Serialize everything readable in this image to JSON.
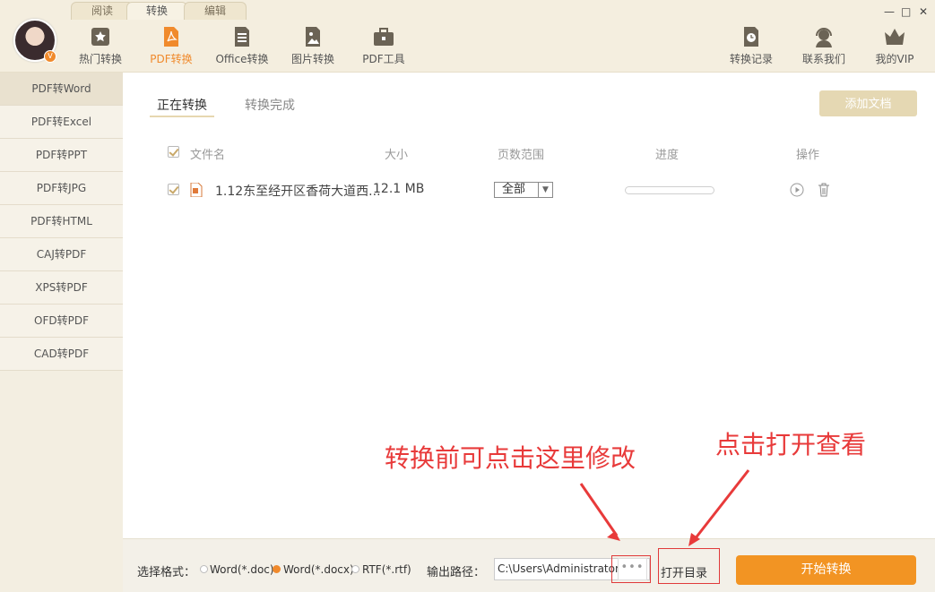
{
  "top_tabs": [
    "阅读",
    "转换",
    "编辑"
  ],
  "avatar_badge": "V",
  "nav": [
    {
      "label": "热门转换",
      "icon": "star-icon"
    },
    {
      "label": "PDF转换",
      "icon": "pdf-icon"
    },
    {
      "label": "Office转换",
      "icon": "document-icon"
    },
    {
      "label": "图片转换",
      "icon": "image-icon"
    },
    {
      "label": "PDF工具",
      "icon": "toolbox-icon"
    }
  ],
  "right_nav": [
    {
      "label": "转换记录",
      "icon": "clock-icon"
    },
    {
      "label": "联系我们",
      "icon": "headset-icon"
    },
    {
      "label": "我的VIP",
      "icon": "crown-icon"
    }
  ],
  "window_controls": {
    "minimize": "—",
    "maximize": "□",
    "close": "✕"
  },
  "sidebar": [
    "PDF转Word",
    "PDF转Excel",
    "PDF转PPT",
    "PDF转JPG",
    "PDF转HTML",
    "CAJ转PDF",
    "XPS转PDF",
    "OFD转PDF",
    "CAD转PDF"
  ],
  "tabs": [
    "正在转换",
    "转换完成"
  ],
  "add_doc": "添加文档",
  "table": {
    "headers": [
      "文件名",
      "大小",
      "页数范围",
      "进度",
      "操作"
    ],
    "row": {
      "filename": "1.12东至经开区香荷大道西...",
      "size": "12.1 MB",
      "page_range": "全部",
      "progress": 0
    }
  },
  "bottom": {
    "format_label": "选择格式：",
    "formats": [
      "Word(*.doc)",
      "Word(*.docx)",
      "RTF(*.rtf)"
    ],
    "selected_format": 1,
    "path_label": "输出路径：",
    "path_value": "C:\\Users\\Administrator",
    "browse": "•••",
    "open_dir": "打开目录",
    "start": "开始转换"
  },
  "annotations": {
    "left": "转换前可点击这里修改",
    "right": "点击打开查看"
  },
  "colors": {
    "accent": "#f08a2c",
    "annotation": "#e83a3a"
  }
}
